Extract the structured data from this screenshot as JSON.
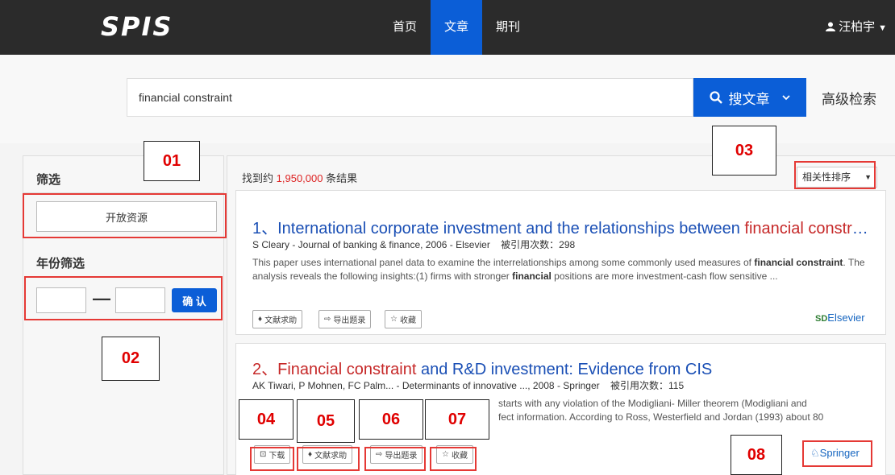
{
  "header": {
    "logo": "SPIS",
    "nav": [
      {
        "label": "首页",
        "active": false
      },
      {
        "label": "文章",
        "active": true
      },
      {
        "label": "期刊",
        "active": false
      }
    ],
    "user": "汪柏宇"
  },
  "search": {
    "value": "financial constraint",
    "button_label": "搜文章",
    "advanced_label": "高级检索"
  },
  "sidebar": {
    "title": "筛选",
    "open_resources": "开放资源",
    "year_title": "年份筛选",
    "dash": "—",
    "confirm": "确 认"
  },
  "results": {
    "count_prefix": "找到约",
    "count_num": "1,950,000",
    "count_suffix": "条结果",
    "sort": "相关性排序",
    "items": [
      {
        "title_prefix": "1、International corporate investment and the relationships between",
        "title_highlight": "financial constrai...",
        "meta": "S Cleary - Journal of banking & finance, 2006 - Elsevier",
        "cited": "被引用次数：298",
        "abstract_1": "This paper uses international panel data to examine the interrelationships among some commonly used measures of",
        "kw1": "financial",
        "kw2": "constraint",
        "abstract_2": ". The analysis reveals the following insights:(1) firms with stronger",
        "kw3": "financial",
        "abstract_3": "positions are more investment-cash flow sensitive ...",
        "actions": [
          "文献求助",
          "导出题录",
          "收藏"
        ],
        "publisher_prefix": "SD",
        "publisher": "Elsevier"
      },
      {
        "title_highlight": "2、Financial constraint",
        "title_suffix": "and R&D investment: Evidence from CIS",
        "meta": "AK Tiwari, P Mohnen, FC Palm... - Determinants of innovative ..., 2008 - Springer",
        "cited": "被引用次数：115",
        "abstract_1": "starts with any violation of the Modigliani- Miller theorem (Modigliani and",
        "abstract_2": "fect information. According to Ross, Westerfield and Jordan (1993) about 80",
        "actions": [
          "下载",
          "文献求助",
          "导出题录",
          "收藏"
        ],
        "publisher": "Springer"
      }
    ]
  },
  "annotations": [
    "01",
    "02",
    "03",
    "04",
    "05",
    "06",
    "07",
    "08"
  ],
  "colors": {
    "accent": "#0b5ed7",
    "highlight": "#c62828",
    "annotation": "#e53935"
  }
}
